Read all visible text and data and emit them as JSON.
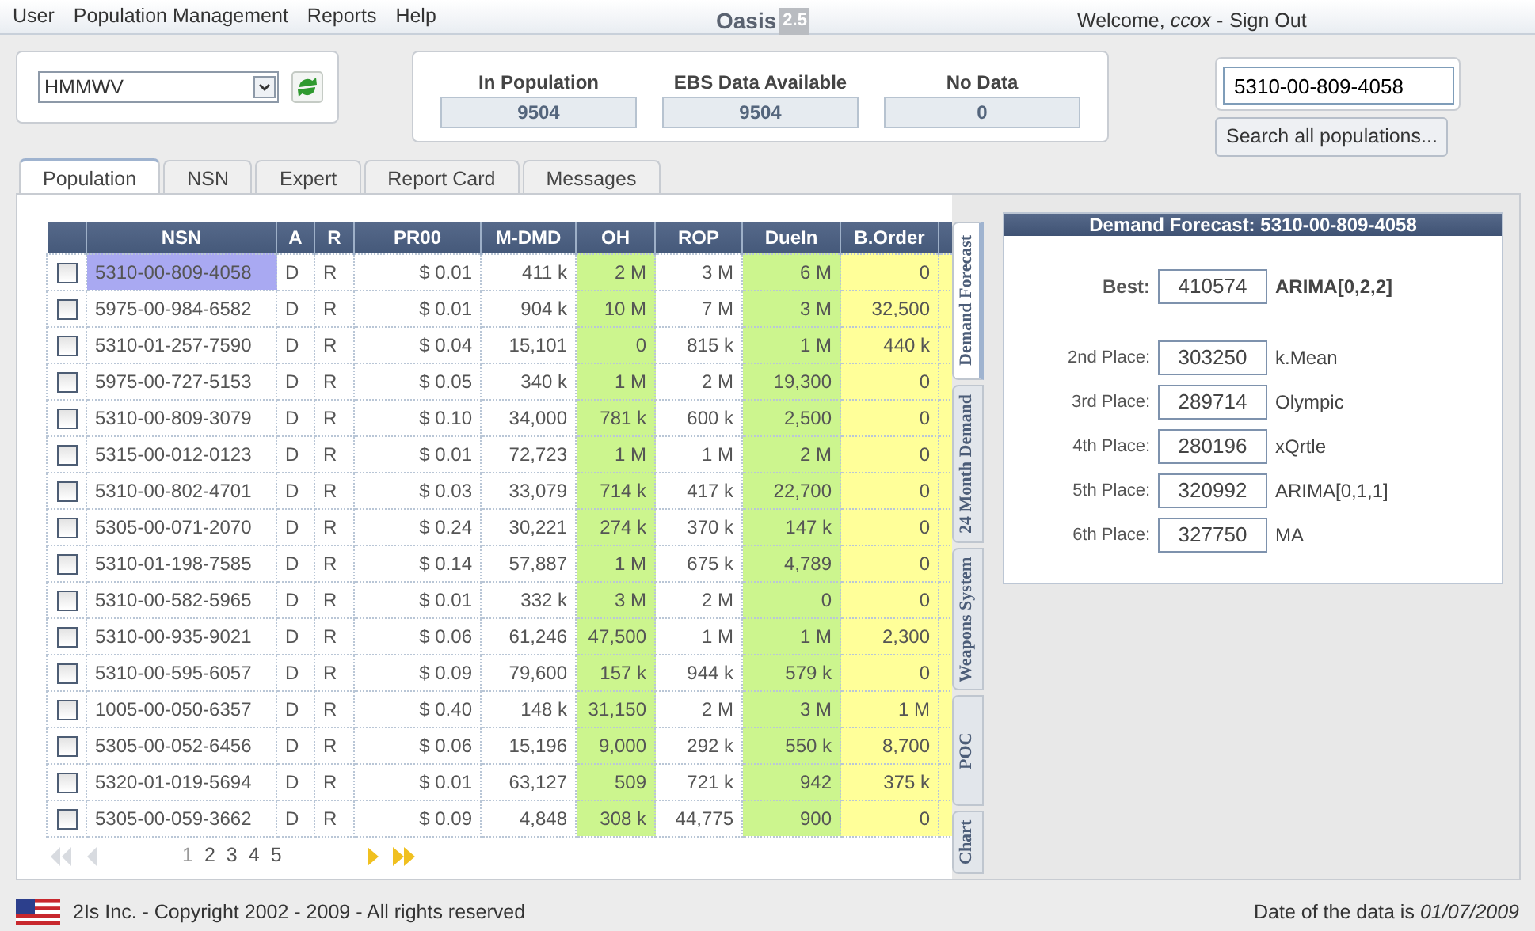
{
  "menu": {
    "items": [
      "User",
      "Population Management",
      "Reports",
      "Help"
    ],
    "logo": "Oasis",
    "version": "2.5",
    "welcome": "Welcome, *ccox* -",
    "sign_out": "Sign Out"
  },
  "population_select": {
    "value": "HMMWV"
  },
  "stats": [
    {
      "label": "In Population",
      "value": "9504"
    },
    {
      "label": "EBS Data Available",
      "value": "9504"
    },
    {
      "label": "No Data",
      "value": "0"
    }
  ],
  "search": {
    "value": "5310-00-809-4058",
    "button": "Search all populations..."
  },
  "tabs": [
    {
      "label": "Population",
      "selected": true
    },
    {
      "label": "NSN",
      "selected": false
    },
    {
      "label": "Expert",
      "selected": false
    },
    {
      "label": "Report Card",
      "selected": false
    },
    {
      "label": "Messages",
      "selected": false
    }
  ],
  "table": {
    "columns": [
      {
        "label": "NSN",
        "color": "#ffffff"
      },
      {
        "label": "A",
        "color": "#ffffff"
      },
      {
        "label": "R",
        "color": "#ffffff"
      },
      {
        "label": "PR00",
        "color": "#ffffff"
      },
      {
        "label": "M-DMD",
        "color": "#ffffff"
      },
      {
        "label": "OH",
        "color": "#ccf58e"
      },
      {
        "label": "ROP",
        "color": "#ffffff"
      },
      {
        "label": "DueIn",
        "color": "#ccf58e"
      },
      {
        "label": "B.Order",
        "color": "#ffff99"
      },
      {
        "color": "#ffff99"
      }
    ],
    "rows": [
      {
        "checked": false,
        "selected": true,
        "cells": [
          "5310-00-809-4058",
          "D",
          "R",
          "$ 0.01",
          "411 k",
          "2 M",
          "3 M",
          "6 M",
          "0"
        ]
      },
      {
        "checked": false,
        "selected": false,
        "cells": [
          "5975-00-984-6582",
          "D",
          "R",
          "$ 0.01",
          "904 k",
          "10 M",
          "7 M",
          "3 M",
          "32,500"
        ]
      },
      {
        "checked": false,
        "selected": false,
        "cells": [
          "5310-01-257-7590",
          "D",
          "R",
          "$ 0.04",
          "15,101",
          "0",
          "815 k",
          "1 M",
          "440 k"
        ]
      },
      {
        "checked": false,
        "selected": false,
        "cells": [
          "5975-00-727-5153",
          "D",
          "R",
          "$ 0.05",
          "340 k",
          "1 M",
          "2 M",
          "19,300",
          "0"
        ]
      },
      {
        "checked": false,
        "selected": false,
        "cells": [
          "5310-00-809-3079",
          "D",
          "R",
          "$ 0.10",
          "34,000",
          "781 k",
          "600 k",
          "2,500",
          "0"
        ]
      },
      {
        "checked": false,
        "selected": false,
        "cells": [
          "5315-00-012-0123",
          "D",
          "R",
          "$ 0.01",
          "72,723",
          "1 M",
          "1 M",
          "2 M",
          "0"
        ]
      },
      {
        "checked": false,
        "selected": false,
        "cells": [
          "5310-00-802-4701",
          "D",
          "R",
          "$ 0.03",
          "33,079",
          "714 k",
          "417 k",
          "22,700",
          "0"
        ]
      },
      {
        "checked": false,
        "selected": false,
        "cells": [
          "5305-00-071-2070",
          "D",
          "R",
          "$ 0.24",
          "30,221",
          "274 k",
          "370 k",
          "147 k",
          "0"
        ]
      },
      {
        "checked": false,
        "selected": false,
        "cells": [
          "5310-01-198-7585",
          "D",
          "R",
          "$ 0.14",
          "57,887",
          "1 M",
          "675 k",
          "4,789",
          "0"
        ]
      },
      {
        "checked": false,
        "selected": false,
        "cells": [
          "5310-00-582-5965",
          "D",
          "R",
          "$ 0.01",
          "332 k",
          "3 M",
          "2 M",
          "0",
          "0"
        ]
      },
      {
        "checked": false,
        "selected": false,
        "cells": [
          "5310-00-935-9021",
          "D",
          "R",
          "$ 0.06",
          "61,246",
          "47,500",
          "1 M",
          "1 M",
          "2,300"
        ]
      },
      {
        "checked": false,
        "selected": false,
        "cells": [
          "5310-00-595-6057",
          "D",
          "R",
          "$ 0.09",
          "79,600",
          "157 k",
          "944 k",
          "579 k",
          "0"
        ]
      },
      {
        "checked": false,
        "selected": false,
        "cells": [
          "1005-00-050-6357",
          "D",
          "R",
          "$ 0.40",
          "148 k",
          "31,150",
          "2 M",
          "3 M",
          "1 M"
        ]
      },
      {
        "checked": false,
        "selected": false,
        "cells": [
          "5305-00-052-6456",
          "D",
          "R",
          "$ 0.06",
          "15,196",
          "9,000",
          "292 k",
          "550 k",
          "8,700"
        ]
      },
      {
        "checked": false,
        "selected": false,
        "cells": [
          "5320-01-019-5694",
          "D",
          "R",
          "$ 0.01",
          "63,127",
          "509",
          "721 k",
          "942",
          "375 k"
        ]
      },
      {
        "checked": false,
        "selected": false,
        "cells": [
          "5305-00-059-3662",
          "D",
          "R",
          "$ 0.09",
          "4,848",
          "308 k",
          "44,775",
          "900",
          "0"
        ]
      }
    ]
  },
  "pager": {
    "pages": [
      {
        "label": "1",
        "selected": true
      },
      {
        "label": "2",
        "selected": false
      },
      {
        "label": "3",
        "selected": false
      },
      {
        "label": "4",
        "selected": false
      },
      {
        "label": "5",
        "selected": false
      }
    ]
  },
  "side_tabs": [
    {
      "label": "Demand Forecast",
      "selected": true
    },
    {
      "label": "24 Month Demand",
      "selected": false
    },
    {
      "label": "Weapons System",
      "selected": false
    },
    {
      "label": "POC",
      "selected": false
    },
    {
      "label": "Chart",
      "selected": false
    }
  ],
  "forecast": {
    "title": "Demand Forecast: 5310-00-809-4058",
    "best": {
      "label": "Best:",
      "value": "410574",
      "method": "ARIMA[0,2,2]"
    },
    "places": [
      {
        "label": "2nd Place:",
        "value": "303250",
        "method": "k.Mean"
      },
      {
        "label": "3rd Place:",
        "value": "289714",
        "method": "Olympic"
      },
      {
        "label": "4th Place:",
        "value": "280196",
        "method": "xQrtle"
      },
      {
        "label": "5th Place:",
        "value": "320992",
        "method": "ARIMA[0,1,1]"
      },
      {
        "label": "6th Place:",
        "value": "327750",
        "method": "MA"
      }
    ]
  },
  "footer": {
    "copyright": "2Is Inc. - Copyright 2002 - 2009 - All rights reserved",
    "date": "Date of the data is *01/07/2009*"
  }
}
